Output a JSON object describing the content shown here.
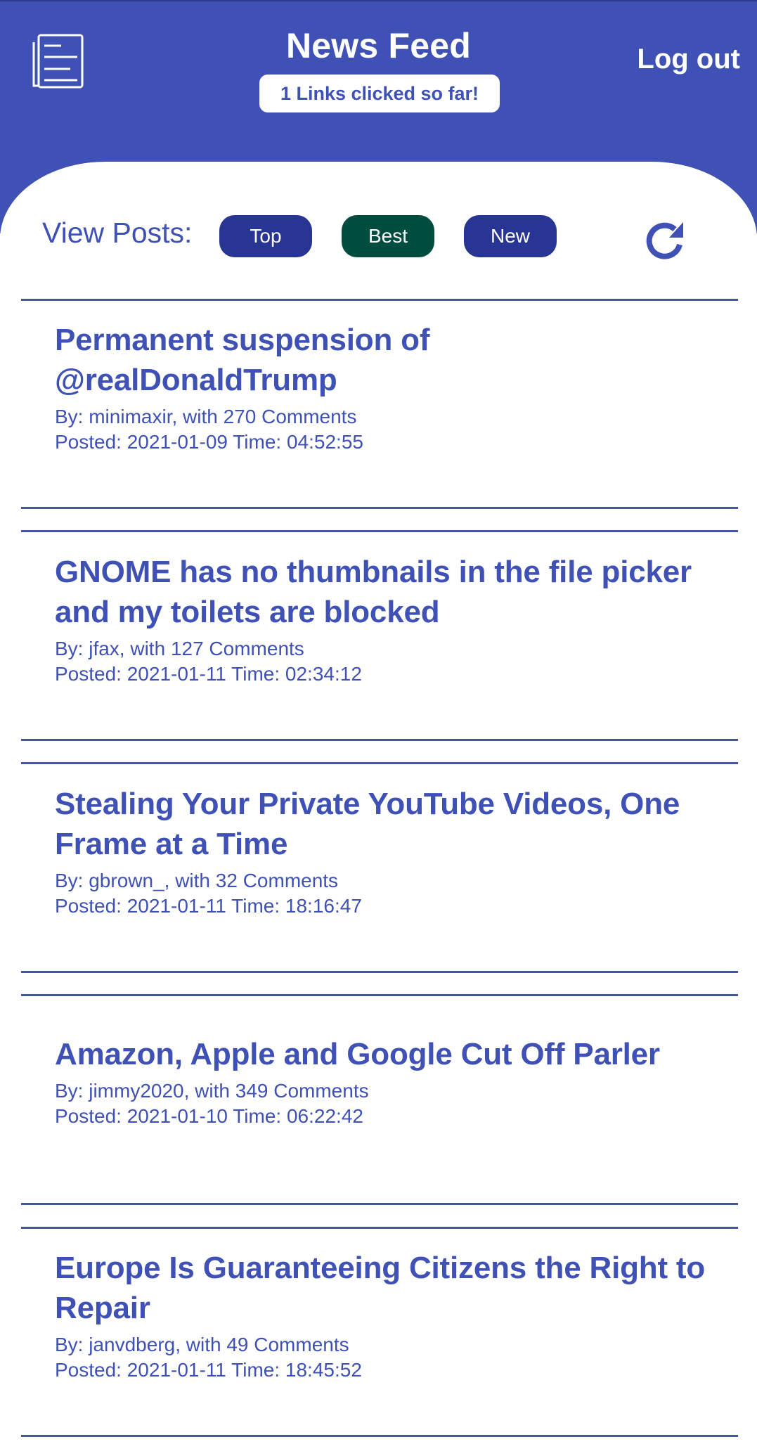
{
  "header": {
    "title": "News Feed",
    "links_clicked_badge": "1 Links clicked so far!",
    "logout_label": "Log out",
    "logo_icon": "newspaper-icon"
  },
  "controls": {
    "view_label": "View Posts:",
    "filters": [
      {
        "label": "Top",
        "active": false
      },
      {
        "label": "Best",
        "active": true
      },
      {
        "label": "New",
        "active": false
      }
    ],
    "refresh_icon": "refresh-icon"
  },
  "colors": {
    "primary": "#3f51b5",
    "button_default": "#283593",
    "button_active": "#004d40",
    "divider": "#44559a"
  },
  "posts": [
    {
      "title": "Permanent suspension of @realDonaldTrump",
      "byline": "By: minimaxir, with 270 Comments",
      "posted": "Posted: 2021-01-09 Time: 04:52:55"
    },
    {
      "title": "GNOME has no thumbnails in the file picker and my toilets are blocked",
      "byline": "By: jfax, with 127 Comments",
      "posted": "Posted: 2021-01-11 Time: 02:34:12"
    },
    {
      "title": "Stealing Your Private YouTube Videos, One Frame at a Time",
      "byline": "By: gbrown_, with 32 Comments",
      "posted": "Posted: 2021-01-11 Time: 18:16:47"
    },
    {
      "title": "Amazon, Apple and Google Cut Off Parler",
      "byline": "By: jimmy2020, with 349 Comments",
      "posted": "Posted: 2021-01-10 Time: 06:22:42"
    },
    {
      "title": "Europe Is Guaranteeing Citizens the Right to Repair",
      "byline": "By: janvdberg, with 49 Comments",
      "posted": "Posted: 2021-01-11 Time: 18:45:52"
    }
  ]
}
